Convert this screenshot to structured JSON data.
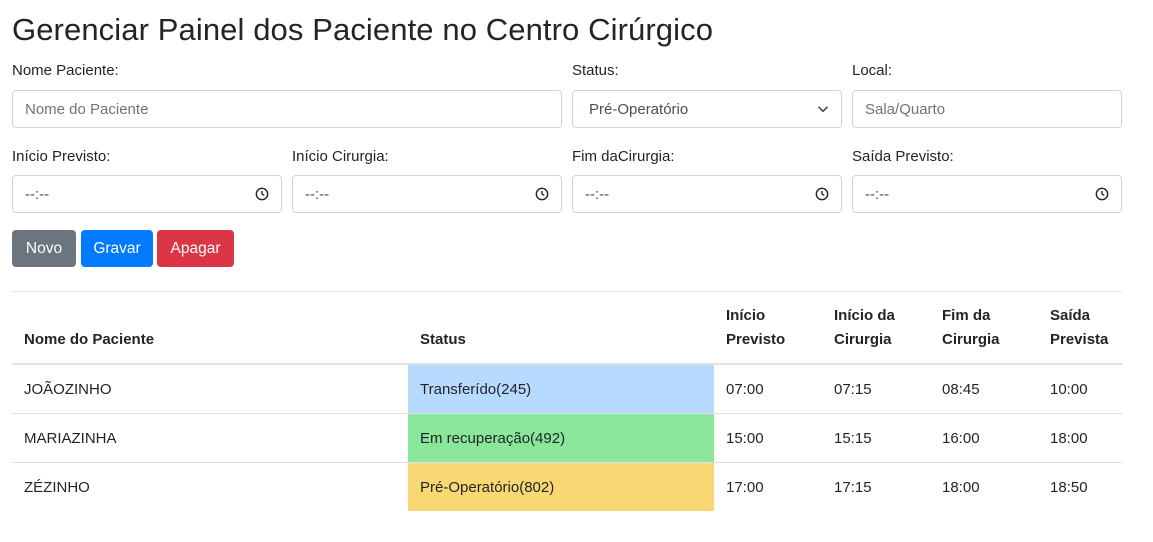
{
  "page": {
    "title": "Gerenciar Painel dos Paciente no Centro Cirúrgico"
  },
  "form": {
    "nome": {
      "label": "Nome Paciente:",
      "placeholder": "Nome do Paciente"
    },
    "status": {
      "label": "Status:",
      "value": "Pré-Operatório"
    },
    "local": {
      "label": "Local:",
      "placeholder": "Sala/Quarto"
    },
    "inicio_previsto": {
      "label": "Início Previsto:",
      "value": "--:--"
    },
    "inicio_cirurgia": {
      "label": "Início Cirurgia:",
      "value": "--:--"
    },
    "fim_cirurgia": {
      "label": "Fim daCirurgia:",
      "value": "--:--"
    },
    "saida_previsto": {
      "label": "Saída Previsto:",
      "value": "--:--"
    }
  },
  "buttons": {
    "novo": "Novo",
    "gravar": "Gravar",
    "apagar": "Apagar"
  },
  "colors": {
    "novo": "#6c757d",
    "gravar": "#007bff",
    "apagar": "#dc3545",
    "status_transferido": "#b8daff",
    "status_recuperacao": "#8ae69b",
    "status_pre_operatorio": "#f9d873"
  },
  "table": {
    "headers": {
      "nome": "Nome do Paciente",
      "status": "Status",
      "inicio_previsto_1": "Início",
      "inicio_previsto_2": "Previsto",
      "inicio_cirurgia_1": "Início da",
      "inicio_cirurgia_2": "Cirurgia",
      "fim_cirurgia_1": "Fim da",
      "fim_cirurgia_2": "Cirurgia",
      "saida_prevista_1": "Saída",
      "saida_prevista_2": "Prevista"
    },
    "rows": [
      {
        "nome": "JOÃOZINHO",
        "status": "Transferído(245)",
        "inicio_previsto": "07:00",
        "inicio_cirurgia": "07:15",
        "fim_cirurgia": "08:45",
        "saida_prevista": "10:00"
      },
      {
        "nome": "MARIAZINHA",
        "status": "Em recuperação(492)",
        "inicio_previsto": "15:00",
        "inicio_cirurgia": "15:15",
        "fim_cirurgia": "16:00",
        "saida_prevista": "18:00"
      },
      {
        "nome": "ZÉZINHO",
        "status": "Pré-Operatório(802)",
        "inicio_previsto": "17:00",
        "inicio_cirurgia": "17:15",
        "fim_cirurgia": "18:00",
        "saida_prevista": "18:50"
      }
    ]
  }
}
